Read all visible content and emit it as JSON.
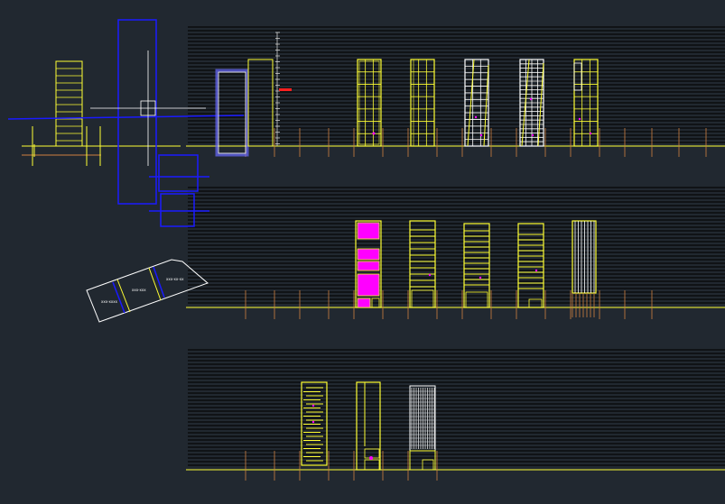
{
  "viewport": {
    "background": "#212830",
    "colors": {
      "yellow": "#ffff33",
      "blue": "#1a1aff",
      "white": "#ffffff",
      "magenta": "#ff00ff",
      "orange": "#d08040",
      "red": "#ff2020",
      "grey": "#cccccc",
      "rule": "#0a0c0e"
    }
  },
  "site_plan": {
    "parcel_labels": [
      "xxx-xxxx",
      "xxx-xxx",
      "xxx-xx-xx"
    ]
  },
  "rows": [
    {
      "id": "elevation-row-1",
      "building_count": 5
    },
    {
      "id": "elevation-row-2",
      "building_count": 5
    },
    {
      "id": "elevation-row-3",
      "building_count": 3
    }
  ]
}
